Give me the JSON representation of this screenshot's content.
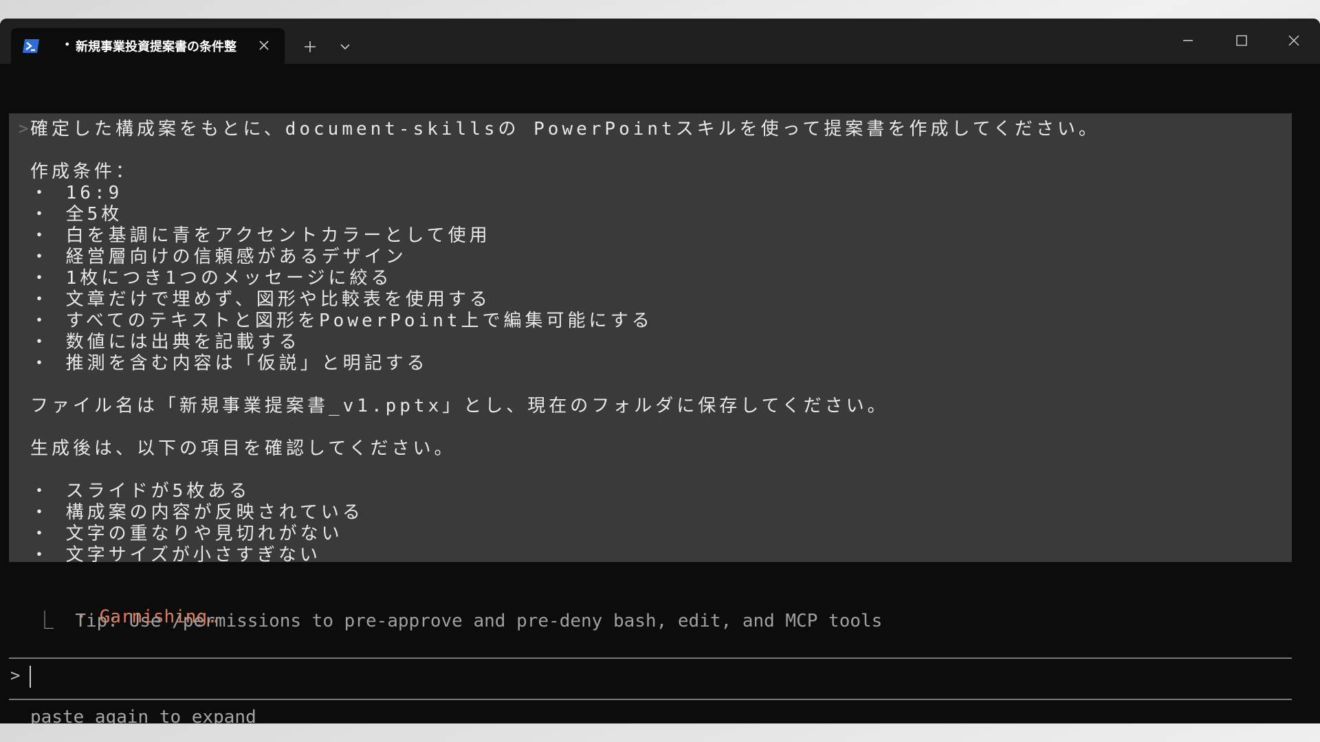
{
  "window": {
    "tab_title": "新規事業投資提案書の条件整",
    "tab_dot": "•",
    "tab_icon": "powershell-icon"
  },
  "prompt": {
    "gt_symbol": ">",
    "intro": "確定した構成案をもとに、document-skillsの PowerPointスキルを使って提案書を作成してください。",
    "conditions_heading": "作成条件：",
    "conditions": [
      "・ 16:9",
      "・ 全5枚",
      "・ 白を基調に青をアクセントカラーとして使用",
      "・ 経営層向けの信頼感があるデザイン",
      "・ 1枚につき1つのメッセージに絞る",
      "・ 文章だけで埋めず、図形や比較表を使用する",
      "・ すべてのテキストと図形をPowerPoint上で編集可能にする",
      "・ 数値には出典を記載する",
      "・ 推測を含む内容は「仮説」と明記する"
    ],
    "file_instruction": "ファイル名は「新規事業提案書_v1.pptx」とし、現在のフォルダに保存してください。",
    "check_heading": "生成後は、以下の項目を確認してください。",
    "checks": [
      "・ スライドが5枚ある",
      "・ 構成案の内容が反映されている",
      "・ 文字の重なりや見切れがない",
      "・ 文字サイズが小さすぎない"
    ]
  },
  "status": {
    "dot": "·",
    "label": "Garnishing…",
    "tip": "⎿  Tip: Use /permissions to pre-approve and pre-deny bash, edit, and MCP tools"
  },
  "input": {
    "prompt_symbol": ">",
    "hint": "paste again to expand"
  },
  "colors": {
    "status_accent": "#e07b5a",
    "prompt_block_bg": "#3a3a3a",
    "terminal_bg": "#0c0c0c",
    "titlebar_bg": "#1f1f1f"
  }
}
